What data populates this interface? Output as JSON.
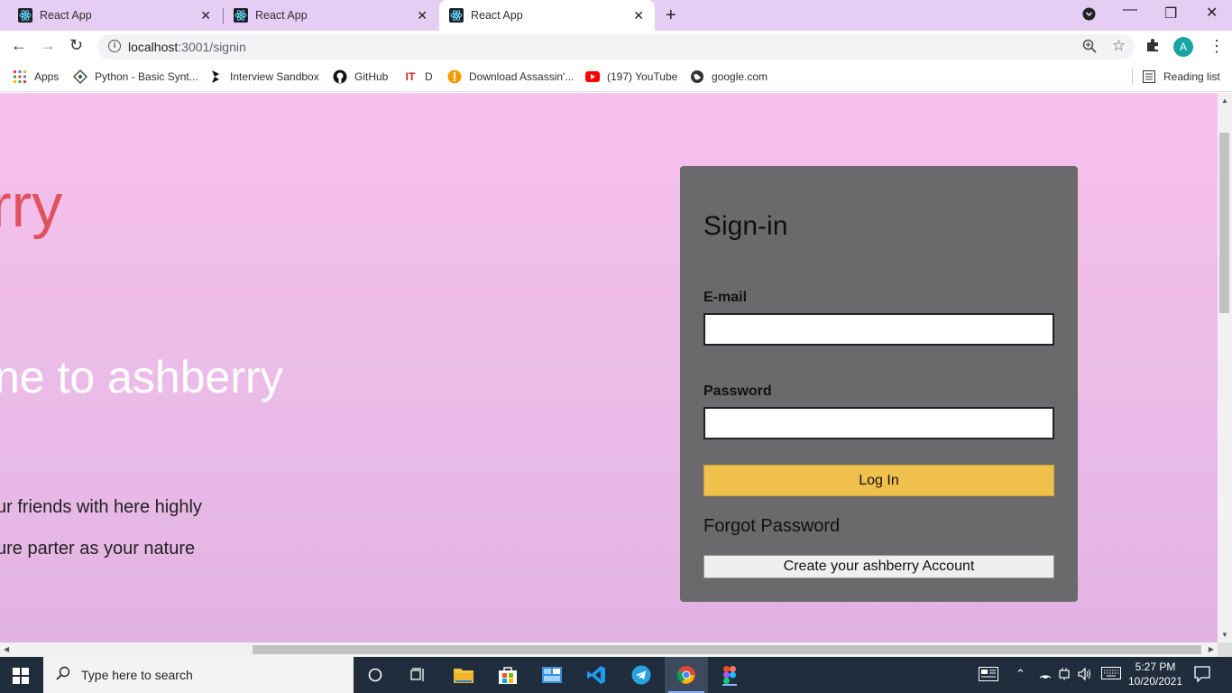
{
  "browser": {
    "tabs": [
      {
        "title": "React App",
        "active": false
      },
      {
        "title": "React App",
        "active": false
      },
      {
        "title": "React App",
        "active": true
      }
    ],
    "url_host": "localhost",
    "url_rest": ":3001/signin",
    "avatar_letter": "A",
    "bookmarks": [
      {
        "label": "Apps",
        "icon": "apps-grid-icon"
      },
      {
        "label": "Python - Basic Synt...",
        "icon": "python-icon"
      },
      {
        "label": "Interview Sandbox",
        "icon": "sandbox-icon"
      },
      {
        "label": "GitHub",
        "icon": "github-icon"
      },
      {
        "label": "D",
        "icon": "it-icon"
      },
      {
        "label": "Download Assassin'...",
        "icon": "download-icon"
      },
      {
        "label": "(197) YouTube",
        "icon": "youtube-icon"
      },
      {
        "label": "google.com",
        "icon": "globe-icon"
      }
    ],
    "reading_list": "Reading list"
  },
  "page": {
    "brand": "rry",
    "welcome": "ne to ashberry",
    "desc_line1": "ur friends with here highly",
    "desc_line2": "ure parter as your nature",
    "signin": {
      "title": "Sign-in",
      "email_label": "E-mail",
      "email_value": "",
      "password_label": "Password",
      "password_value": "",
      "login_button": "Log In",
      "forgot": "Forgot Password",
      "create_button": "Create your ashberry Account"
    }
  },
  "taskbar": {
    "search_placeholder": "Type here to search",
    "time": "5:27 PM",
    "date": "10/20/2021"
  },
  "colors": {
    "brand": "#e0535e",
    "card": "#6a6a6c",
    "login_button": "#f0c04c",
    "page_bg_top": "#f8c0ec"
  }
}
